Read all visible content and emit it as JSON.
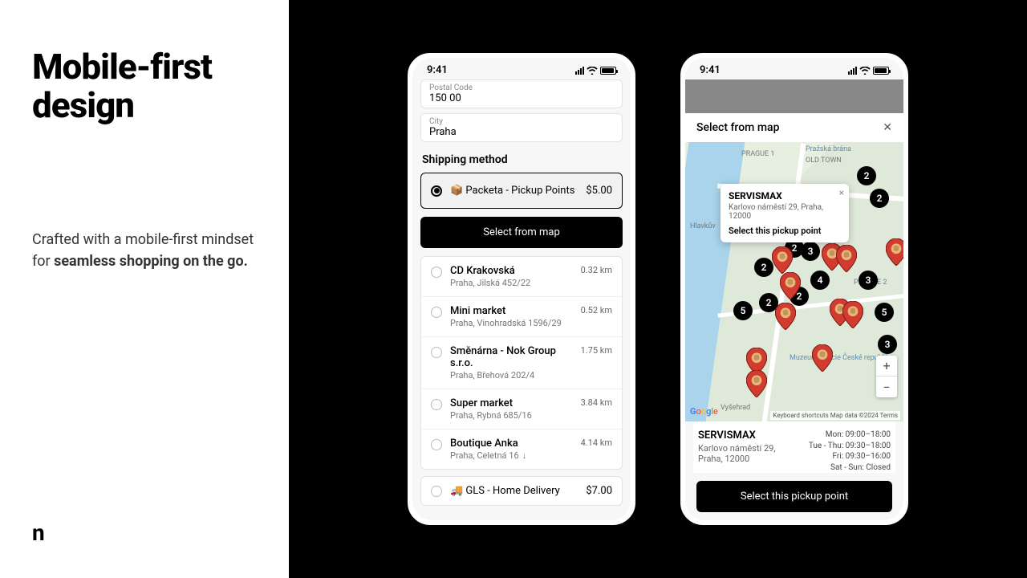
{
  "hero": {
    "title": "Mobile-first design",
    "desc_pre": "Crafted with a mobile-first mindset for ",
    "desc_bold": "seamless shopping on the go.",
    "logo": "n"
  },
  "status_time": "9:41",
  "p1": {
    "postal_label": "Postal Code",
    "postal_value": "150 00",
    "city_label": "City",
    "city_value": "Praha",
    "section": "Shipping method",
    "packeta_label": "📦 Packeta - Pickup Points",
    "packeta_price": "$5.00",
    "map_btn": "Select from map",
    "pickups": [
      {
        "name": "CD Krakovská",
        "addr": "Praha, Jilská 452/22",
        "dist": "0.32 km"
      },
      {
        "name": "Mini market",
        "addr": "Praha, Vinohradská 1596/29",
        "dist": "0.52 km"
      },
      {
        "name": "Směnárna - Nok Group s.r.o.",
        "addr": "Praha, Břehová 202/4",
        "dist": "1.75 km"
      },
      {
        "name": "Super market",
        "addr": "Praha, Rybná 685/16",
        "dist": "3.84 km"
      },
      {
        "name": "Boutique Anka",
        "addr": "Praha, Celetná 16",
        "dist": "4.14 km",
        "arrow": true
      }
    ],
    "gls_label": "🚚 GLS - Home Delivery",
    "gls_price": "$7.00"
  },
  "p2": {
    "header": "Select from map",
    "popup_name": "SERVISMAX",
    "popup_addr": "Karlovo náměstí 29, Praha, 12000",
    "popup_btn": "Select this pickup point",
    "detail_name": "SERVISMAX",
    "detail_addr": "Karlovo náměstí 29, Praha, 12000",
    "hours": [
      "Mon: 09:00–18:00",
      "Tue - Thu: 09:30–18:00",
      "Fri: 09:30–16:00",
      "Sat - Sun: Closed"
    ],
    "select_btn": "Select this pickup point",
    "attr": "Keyboard shortcuts   Map data ©2024   Terms",
    "labels": {
      "p1": "PRAGUE 1",
      "ot": "OLD TOWN",
      "pb": "Pražská brána",
      "mp": "Muzeum Policie České republiky",
      "vy": "Vyšehrad",
      "p2": "PRAGUE 2",
      "hl": "Hlavkův"
    }
  }
}
